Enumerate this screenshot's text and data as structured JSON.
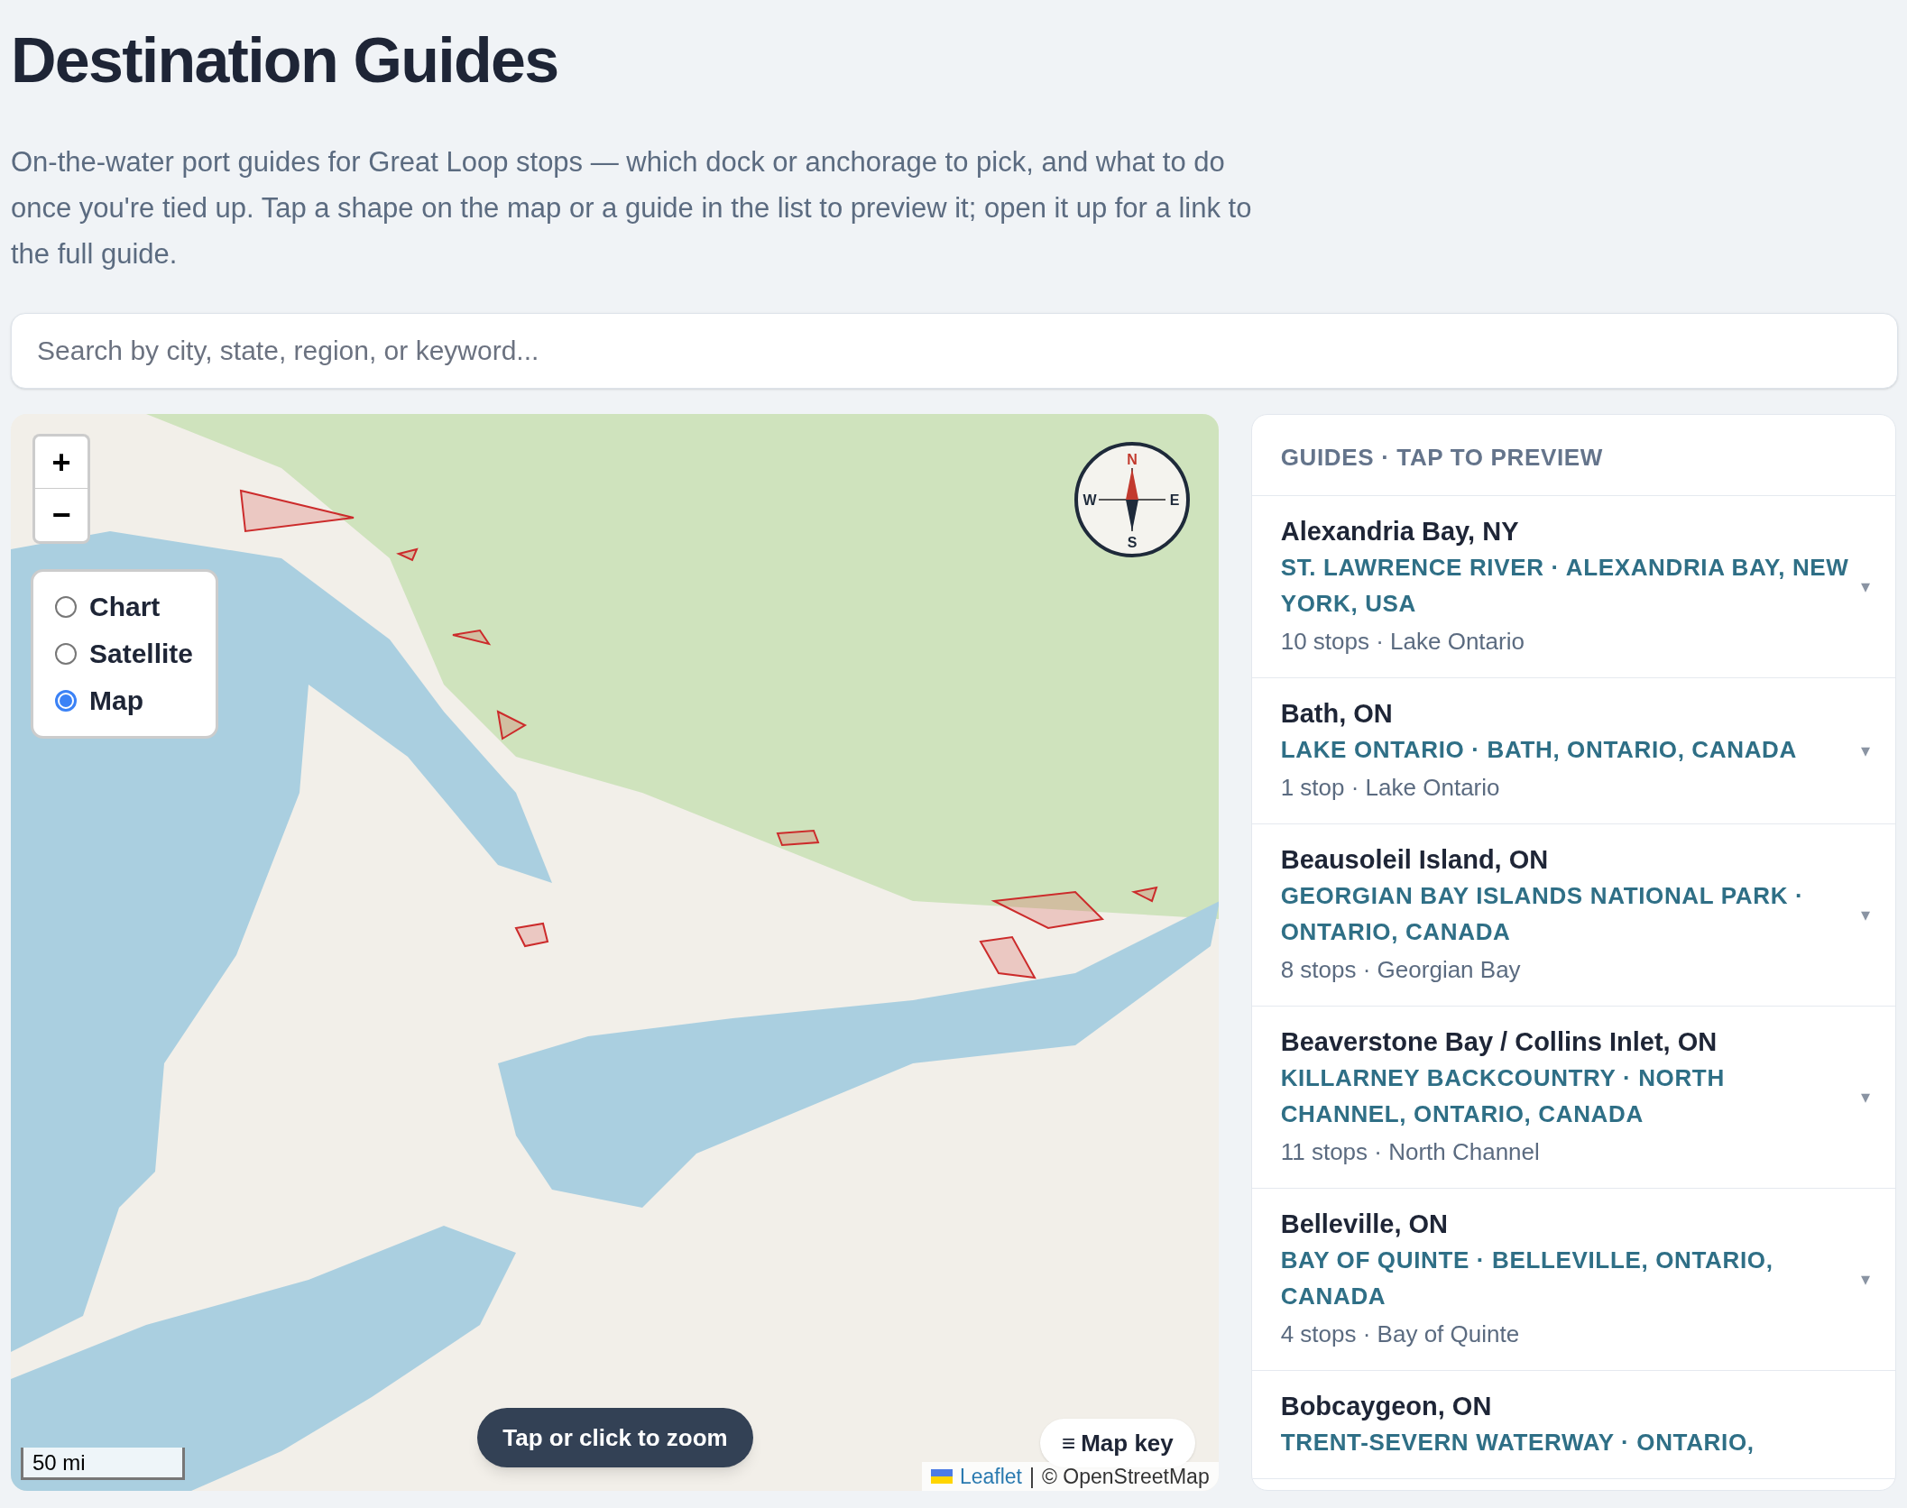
{
  "title": "Destination Guides",
  "intro": "On-the-water port guides for Great Loop stops — which dock or anchorage to pick, and what to do once you're tied up. Tap a shape on the map or a guide in the list to preview it; open it up for a link to the full guide.",
  "search": {
    "placeholder": "Search by city, state, region, or keyword..."
  },
  "map": {
    "zoom_buttons": [
      "+",
      "−"
    ],
    "layers": [
      {
        "label": "Chart",
        "selected": false
      },
      {
        "label": "Satellite",
        "selected": false
      },
      {
        "label": "Map",
        "selected": true
      }
    ],
    "compass": {
      "north": "N",
      "east": "E",
      "south": "S",
      "west": "W"
    },
    "scale": "50 mi",
    "zoom_hint": "Tap or click to zoom",
    "map_key": {
      "icon": "≡",
      "label": "Map key"
    },
    "attribution": {
      "link": "Leaflet",
      "separator": "|",
      "text": "© OpenStreetMap"
    }
  },
  "guides": {
    "header": "GUIDES · TAP TO PREVIEW",
    "items": [
      {
        "title": "Alexandria Bay, NY",
        "subtitle": "ST. LAWRENCE RIVER · ALEXANDRIA BAY, NEW YORK, USA",
        "meta": "10 stops · Lake Ontario",
        "expander": "▾"
      },
      {
        "title": "Bath, ON",
        "subtitle": "LAKE ONTARIO · BATH, ONTARIO, CANADA",
        "meta": "1 stop · Lake Ontario",
        "expander": "▾"
      },
      {
        "title": "Beausoleil Island, ON",
        "subtitle": "GEORGIAN BAY ISLANDS NATIONAL PARK · ONTARIO, CANADA",
        "meta": "8 stops · Georgian Bay",
        "expander": "▾"
      },
      {
        "title": "Beaverstone Bay / Collins Inlet, ON",
        "subtitle": "KILLARNEY BACKCOUNTRY · NORTH CHANNEL, ONTARIO, CANADA",
        "meta": "11 stops · North Channel",
        "expander": "▾"
      },
      {
        "title": "Belleville, ON",
        "subtitle": "BAY OF QUINTE · BELLEVILLE, ONTARIO, CANADA",
        "meta": "4 stops · Bay of Quinte",
        "expander": "▾"
      },
      {
        "title": "Bobcaygeon, ON",
        "subtitle": "TRENT-SEVERN WATERWAY · ONTARIO,"
      }
    ]
  }
}
